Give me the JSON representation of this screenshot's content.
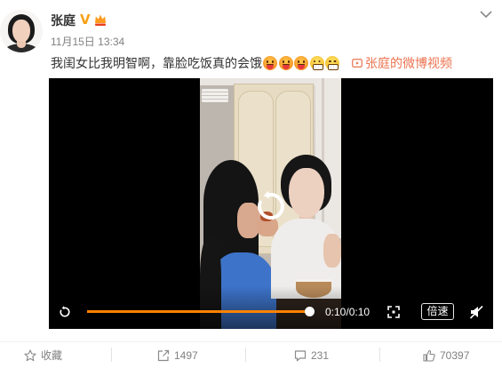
{
  "post": {
    "author": "张庭",
    "verified_badge": "V",
    "verified_icon": "verified-v-icon",
    "vip_icon": "vip-crown-icon",
    "menu_icon": "chevron-down-icon",
    "time": "11月15日 13:34",
    "text": "我闺女比我明智啊，靠脸吃饭真的会饿",
    "emojis": [
      "tongue-out-emoji-icon",
      "tongue-out-emoji-icon",
      "tongue-out-emoji-icon",
      "grin-teeth-emoji-icon",
      "grin-teeth-emoji-icon"
    ],
    "video_link": {
      "icon": "video-icon",
      "text": "张庭的微博视频"
    }
  },
  "player": {
    "center_icon": "replay-icon",
    "progress": 1,
    "time": "0:10/0:10",
    "speed_label": "倍速",
    "control_icons": [
      "replay-icon",
      "fullscreen-icon",
      "volume-muted-icon"
    ]
  },
  "actions": [
    {
      "icon": "star-icon",
      "label": "收藏"
    },
    {
      "icon": "share-icon",
      "label": "1497"
    },
    {
      "icon": "comment-icon",
      "label": "231"
    },
    {
      "icon": "thumbs-up-icon",
      "label": "70397"
    }
  ],
  "colors": {
    "accent": "#ff8200",
    "link": "#eb7350",
    "verified": "#f7a219",
    "text": "#333333",
    "muted": "#808080"
  }
}
